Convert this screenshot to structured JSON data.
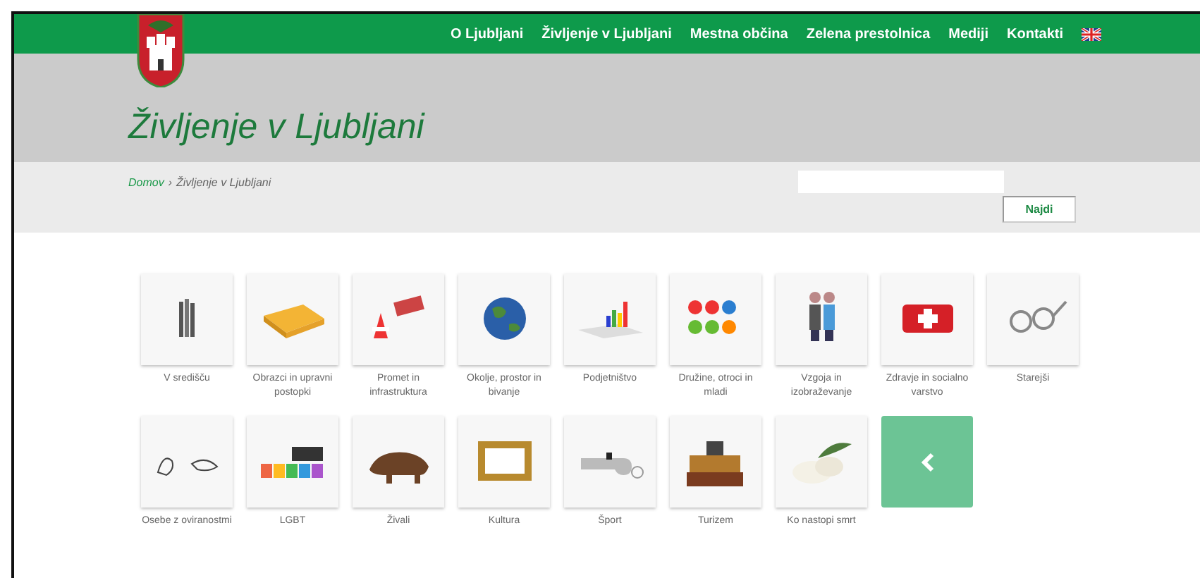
{
  "nav": {
    "items": [
      {
        "label": "O Ljubljani"
      },
      {
        "label": "Življenje v Ljubljani"
      },
      {
        "label": "Mestna občina"
      },
      {
        "label": "Zelena prestolnica"
      },
      {
        "label": "Mediji"
      },
      {
        "label": "Kontakti"
      }
    ]
  },
  "header": {
    "title": "Življenje v Ljubljani"
  },
  "breadcrumb": [
    {
      "label": "Domov",
      "kind": "link"
    },
    {
      "label": "›",
      "kind": "separator"
    },
    {
      "label": "Življenje v Ljubljani",
      "kind": "current"
    }
  ],
  "search": {
    "button": "Najdi"
  },
  "tiles": [
    {
      "kind": "picture",
      "label": "V središču"
    },
    {
      "kind": "picture",
      "label": "Obrazci in upravni postopki"
    },
    {
      "kind": "picture",
      "label": "Promet in infrastruktura"
    },
    {
      "kind": "picture",
      "label": "Okolje, prostor in bivanje"
    },
    {
      "kind": "picture",
      "label": "Podjetništvo"
    },
    {
      "kind": "picture",
      "label": "Družine, otroci in mladi"
    },
    {
      "kind": "picture",
      "label": "Vzgoja in izobraževanje"
    },
    {
      "kind": "picture",
      "label": "Zdravje in socialno varstvo"
    },
    {
      "kind": "picture",
      "label": "Starejši"
    },
    {
      "kind": "picture",
      "label": "Osebe z oviranostmi"
    },
    {
      "kind": "picture",
      "label": "LGBT"
    },
    {
      "kind": "picture",
      "label": "Živali"
    },
    {
      "kind": "picture",
      "label": "Kultura"
    },
    {
      "kind": "picture",
      "label": "Šport"
    },
    {
      "kind": "picture",
      "label": "Turizem"
    },
    {
      "kind": "picture",
      "label": "Ko nastopi smrt"
    },
    {
      "kind": "back"
    }
  ]
}
